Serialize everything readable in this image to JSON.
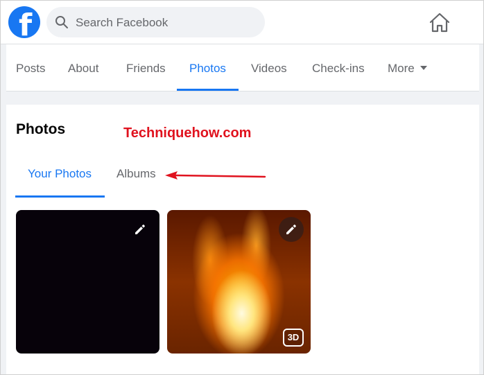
{
  "header": {
    "logo_letter": "f",
    "search": {
      "placeholder": "Search Facebook"
    }
  },
  "nav": {
    "tabs": [
      {
        "label": "Posts"
      },
      {
        "label": "About"
      },
      {
        "label": "Friends"
      },
      {
        "label": "Photos",
        "active": true
      },
      {
        "label": "Videos"
      },
      {
        "label": "Check-ins"
      },
      {
        "label": "More"
      }
    ]
  },
  "photos_section": {
    "title": "Photos",
    "watermark": "Techniquehow.com",
    "subtabs": [
      {
        "label": "Your Photos",
        "active": true
      },
      {
        "label": "Albums"
      }
    ],
    "items": [
      {
        "icon": "edit-pencil-icon"
      },
      {
        "icon": "edit-pencil-icon",
        "badge": "3D"
      }
    ]
  },
  "colors": {
    "brand": "#1877f2",
    "annotation": "#e0121e",
    "muted_text": "#65676b"
  }
}
